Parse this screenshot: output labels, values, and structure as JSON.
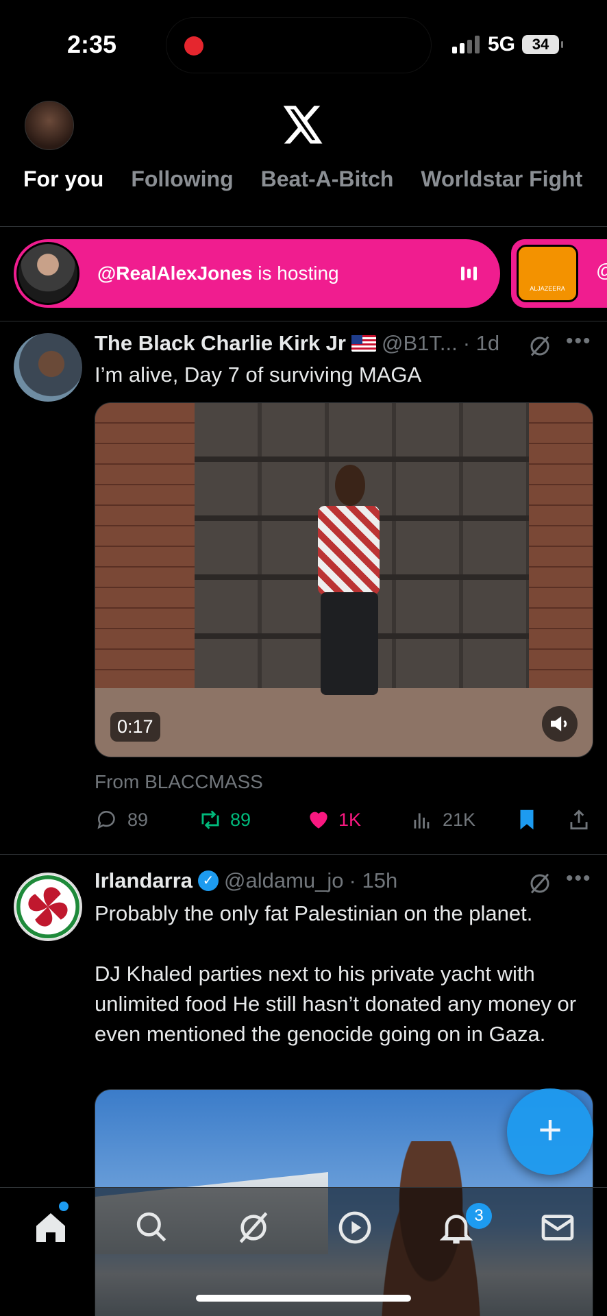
{
  "status": {
    "time": "2:35",
    "network": "5G",
    "battery": "34"
  },
  "header": {
    "tabs": [
      {
        "label": "For you",
        "active": true
      },
      {
        "label": "Following",
        "active": false
      },
      {
        "label": "Beat-A-Bitch",
        "active": false
      },
      {
        "label": "Worldstar Fight",
        "active": false
      }
    ]
  },
  "spaces": {
    "host_handle": "@RealAlexJones",
    "host_suffix": " is hosting",
    "second_logo_text": "ALJAZEERA",
    "second_at": "@"
  },
  "posts": [
    {
      "name": "The Black Charlie Kirk Jr",
      "handle": "@B1T...",
      "time": "· 1d",
      "text": "I’m alive, Day 7 of surviving MAGA",
      "video_duration": "0:17",
      "source": "From BLACCMASS",
      "replies": "89",
      "reposts": "89",
      "likes": "1K",
      "views": "21K"
    },
    {
      "name": "Irlandarra",
      "handle": "@aldamu_jo",
      "time": "· 15h",
      "text_line1": "Probably the only fat Palestinian on the planet.",
      "text_line2": "DJ Khaled parties next to his private yacht with unlimited food He still hasn’t donated any money or even mentioned the genocide going on in Gaza."
    }
  ],
  "fab_label": "+",
  "nav": {
    "notifications_badge": "3"
  },
  "colors": {
    "accent": "#1d9bf0",
    "spaces": "#f01d8f",
    "like": "#f91880",
    "repost": "#00ba7c"
  }
}
